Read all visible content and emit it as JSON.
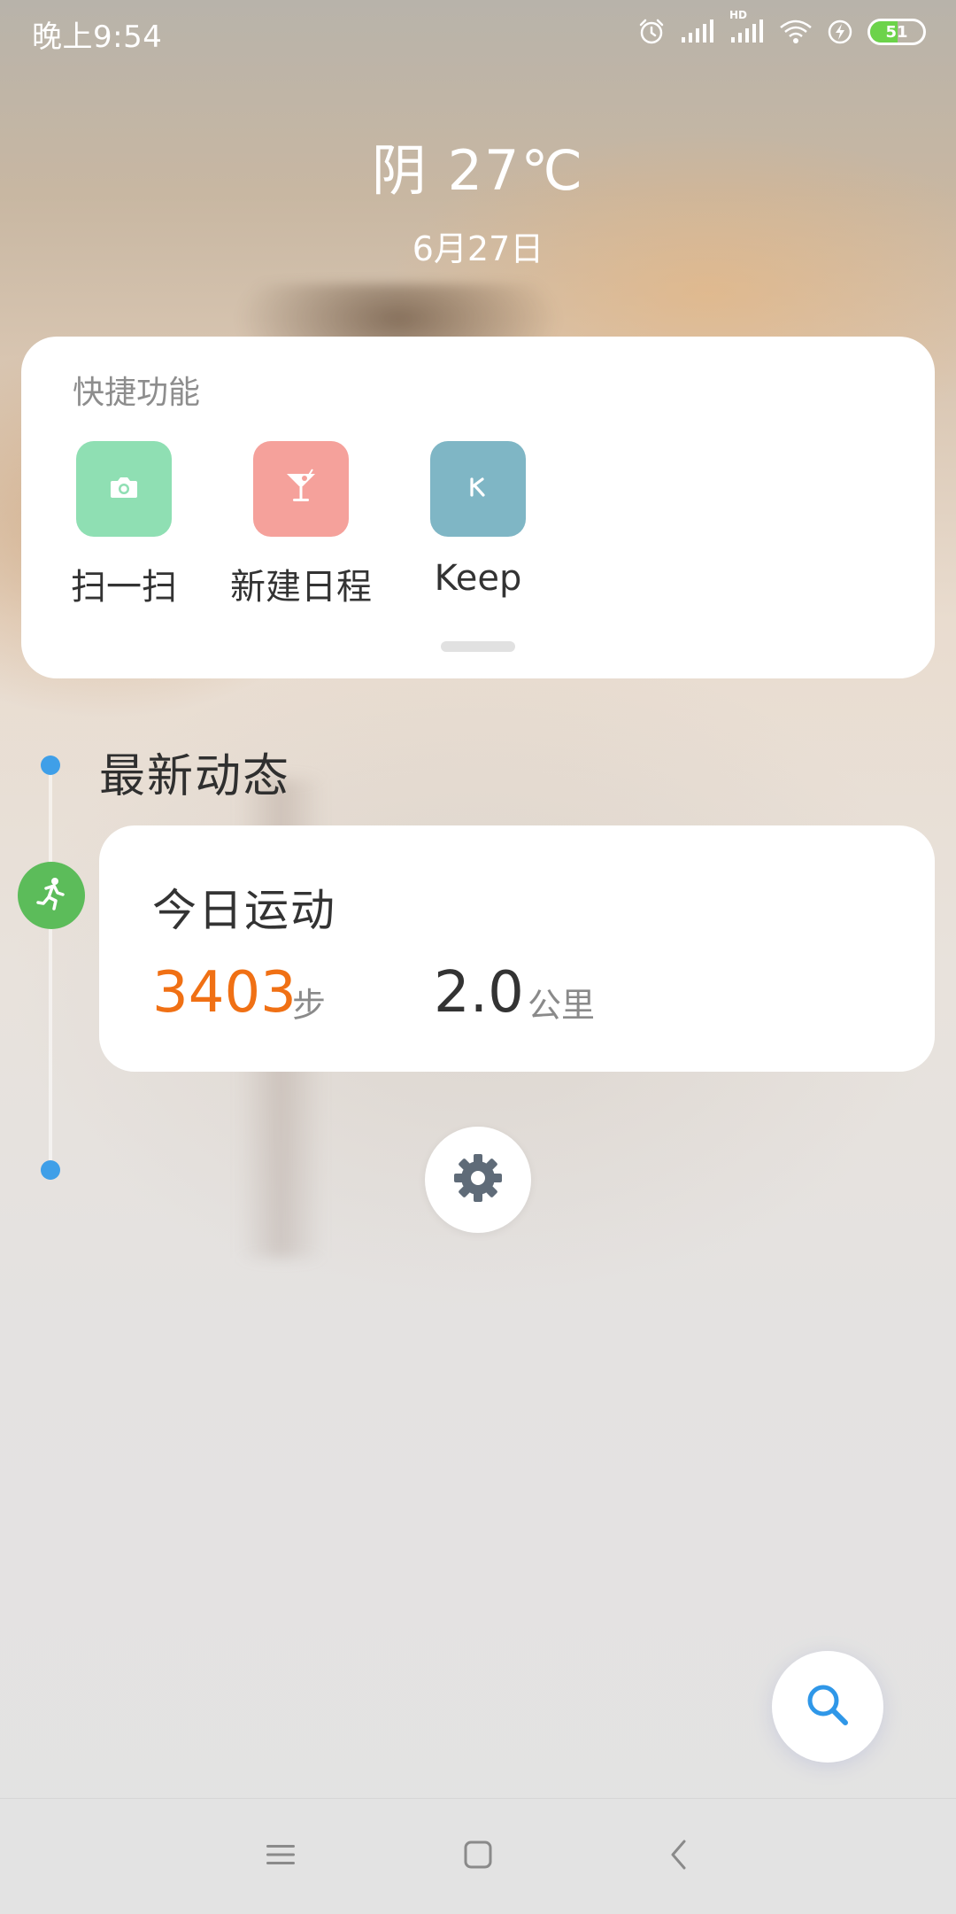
{
  "status_bar": {
    "time": "晚上9:54",
    "network_badge": "HD",
    "battery_percent": "51",
    "icons": [
      "alarm-icon",
      "signal-icon",
      "signal-hd-icon",
      "wifi-icon",
      "charging-icon",
      "battery-icon"
    ]
  },
  "weather": {
    "condition_temp": "阴  27℃",
    "date": "6月27日"
  },
  "quick_functions": {
    "title": "快捷功能",
    "items": [
      {
        "label": "扫一扫",
        "icon": "camera-icon",
        "color": "#8fdfb3"
      },
      {
        "label": "新建日程",
        "icon": "cocktail-icon",
        "color": "#f5a19b"
      },
      {
        "label": "Keep",
        "icon": "keep-logo-icon",
        "glyph": "K",
        "color": "#7fb6c5"
      }
    ]
  },
  "timeline": {
    "section_title": "最新动态",
    "accent_color": "#3f9fe8"
  },
  "sport_card": {
    "title": "今日运动",
    "steps_value": "3403",
    "steps_unit": "步",
    "distance_value": "2.0",
    "distance_unit": "公里",
    "steps_color": "#f07014",
    "badge_icon": "running-icon",
    "badge_color": "#5cbc5a"
  },
  "buttons": {
    "settings_icon": "gear-icon",
    "search_icon": "search-icon"
  },
  "nav_bar": {
    "items": [
      "menu-icon",
      "home-icon",
      "back-icon"
    ]
  }
}
